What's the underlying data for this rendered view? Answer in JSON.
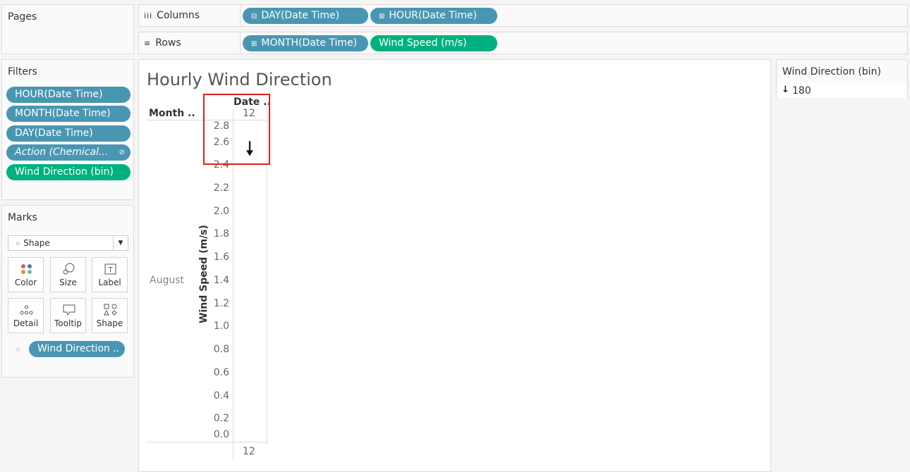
{
  "pages": {
    "title": "Pages"
  },
  "columns_shelf": {
    "label": "Columns",
    "icon": "columns-icon",
    "pills": [
      {
        "label": "DAY(Date Time)",
        "prefix": "⊟",
        "color": "#4996b2"
      },
      {
        "label": "HOUR(Date Time)",
        "prefix": "⊞",
        "color": "#4996b2"
      }
    ]
  },
  "rows_shelf": {
    "label": "Rows",
    "icon": "rows-icon",
    "pills": [
      {
        "label": "MONTH(Date Time)",
        "prefix": "⊞",
        "color": "#4996b2"
      },
      {
        "label": "Wind Speed (m/s)",
        "color": "#00b180"
      }
    ]
  },
  "filters": {
    "title": "Filters",
    "items": [
      {
        "label": "HOUR(Date Time)"
      },
      {
        "label": "MONTH(Date Time)"
      },
      {
        "label": "DAY(Date Time)"
      },
      {
        "label": "Action (Chemical..."
      },
      {
        "label": "Wind Direction (bin)"
      }
    ]
  },
  "marks": {
    "title": "Marks",
    "type_label": "Shape",
    "cards": [
      {
        "label": "Color"
      },
      {
        "label": "Size"
      },
      {
        "label": "Label"
      },
      {
        "label": "Detail"
      },
      {
        "label": "Tooltip"
      },
      {
        "label": "Shape"
      }
    ],
    "field_pill": "Wind Direction .."
  },
  "view": {
    "title": "Hourly Wind Direction",
    "month_header": "Month ..",
    "date_header": "Date ..",
    "hour_top": "12",
    "hour_bottom": "12",
    "month_value": "August",
    "y_axis_title": "Wind Speed (m/s)",
    "y_ticks": [
      "2.8",
      "2.6",
      "2.4",
      "2.2",
      "2.0",
      "1.8",
      "1.6",
      "1.4",
      "1.2",
      "1.0",
      "0.8",
      "0.6",
      "0.4",
      "0.2",
      "0.0"
    ],
    "highlight_color": "#e02020"
  },
  "legend": {
    "title": "Wind Direction (bin)",
    "items": [
      {
        "arrow": "↓",
        "value": "180"
      }
    ]
  },
  "chart_data": {
    "type": "scatter",
    "title": "Hourly Wind Direction",
    "xlabel": "",
    "ylabel": "Wind Speed (m/s)",
    "x": [
      "12"
    ],
    "y": [
      2.6
    ],
    "marker": "down-arrow",
    "marker_direction_bin": 180,
    "ylim": [
      0,
      2.8
    ]
  }
}
